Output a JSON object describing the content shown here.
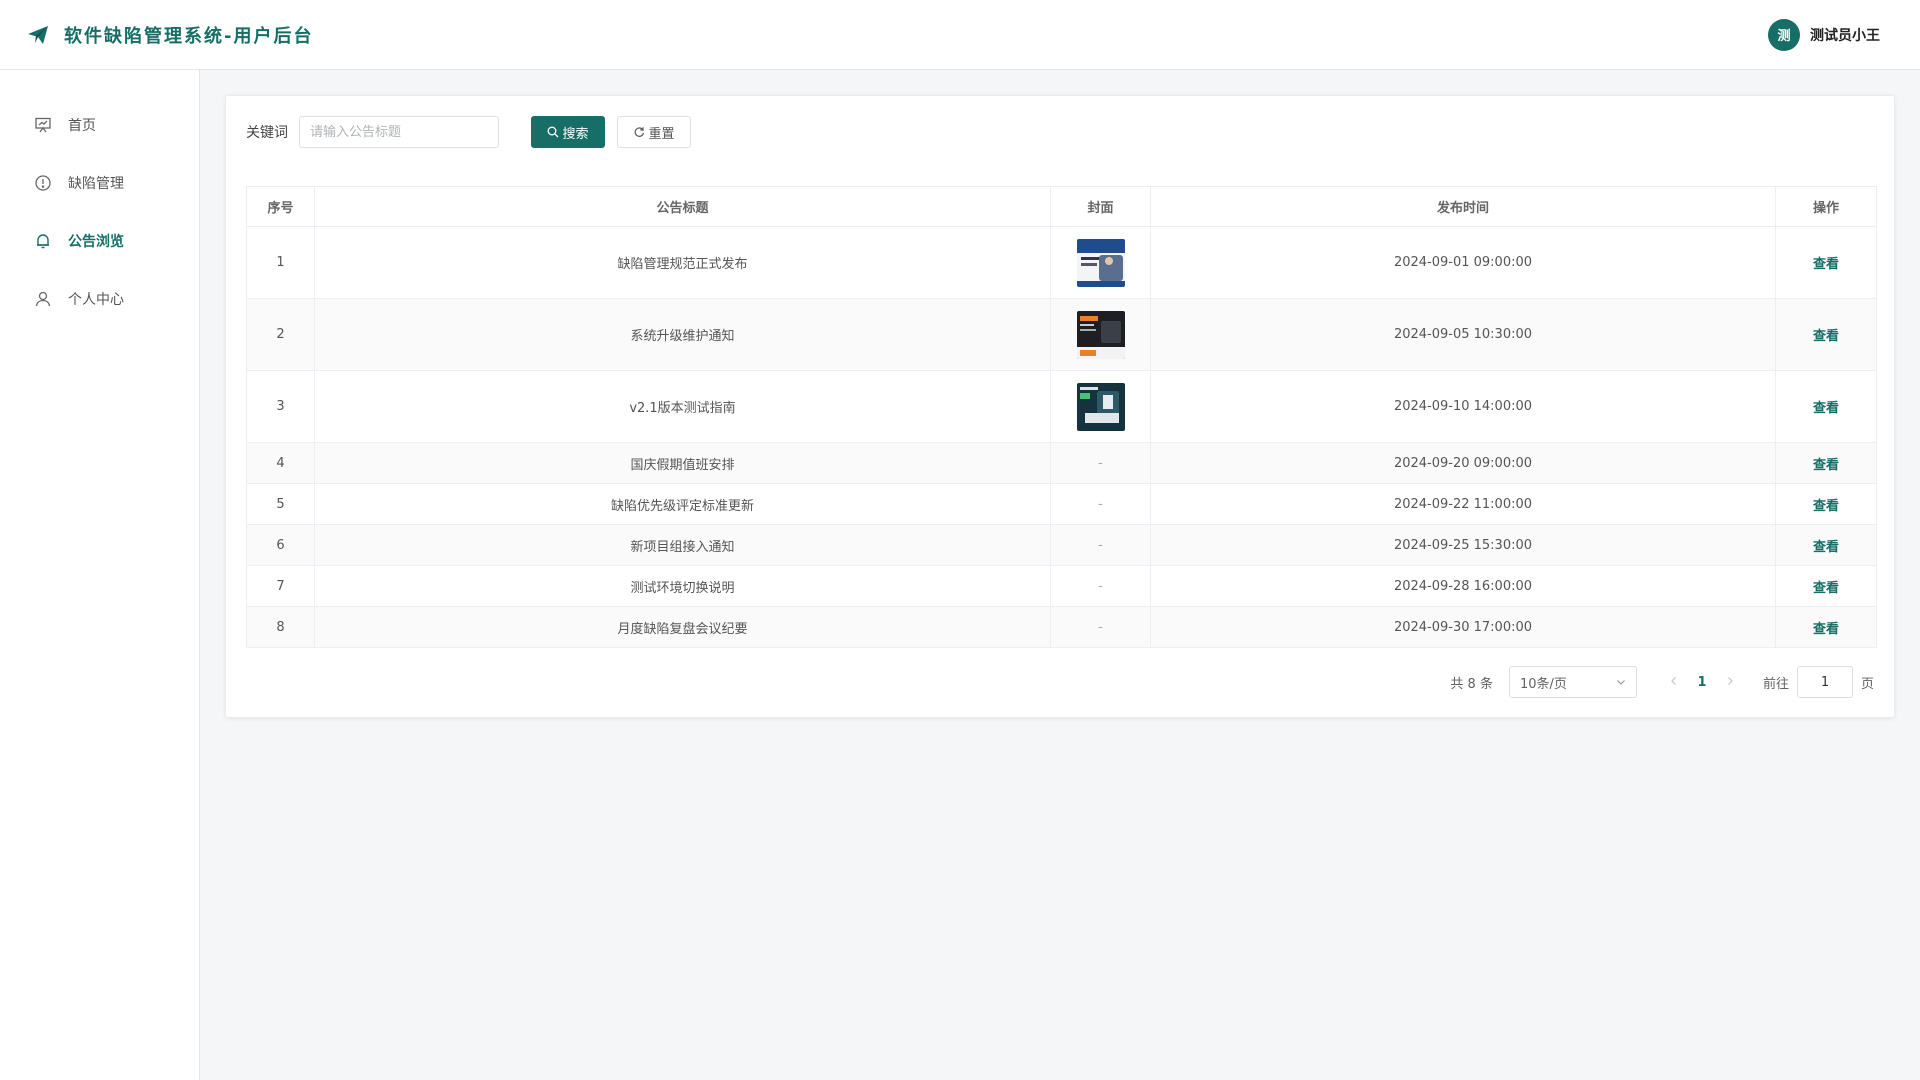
{
  "header": {
    "title": "软件缺陷管理系统-用户后台",
    "brand_icon": "paper-plane-icon",
    "user": {
      "avatar_text": "测",
      "name": "测试员小王"
    }
  },
  "sidebar": {
    "items": [
      {
        "label": "首页",
        "icon": "presentation-board-icon",
        "active": false
      },
      {
        "label": "缺陷管理",
        "icon": "alert-circle-icon",
        "active": false
      },
      {
        "label": "公告浏览",
        "icon": "bell-icon",
        "active": true
      },
      {
        "label": "个人中心",
        "icon": "user-icon",
        "active": false
      }
    ]
  },
  "search": {
    "label": "关键词",
    "placeholder": "请输入公告标题",
    "value": "",
    "search_button": "搜索",
    "reset_button": "重置"
  },
  "table": {
    "columns": [
      "序号",
      "公告标题",
      "封面",
      "发布时间",
      "操作"
    ],
    "rows": [
      {
        "index": "1",
        "title": "缺陷管理规范正式发布",
        "cover": "image",
        "time": "2024-09-01 09:00:00",
        "action": "查看"
      },
      {
        "index": "2",
        "title": "系统升级维护通知",
        "cover": "image",
        "time": "2024-09-05 10:30:00",
        "action": "查看"
      },
      {
        "index": "3",
        "title": "v2.1版本测试指南",
        "cover": "image",
        "time": "2024-09-10 14:00:00",
        "action": "查看"
      },
      {
        "index": "4",
        "title": "国庆假期值班安排",
        "cover": "-",
        "time": "2024-09-20 09:00:00",
        "action": "查看"
      },
      {
        "index": "5",
        "title": "缺陷优先级评定标准更新",
        "cover": "-",
        "time": "2024-09-22 11:00:00",
        "action": "查看"
      },
      {
        "index": "6",
        "title": "新项目组接入通知",
        "cover": "-",
        "time": "2024-09-25 15:30:00",
        "action": "查看"
      },
      {
        "index": "7",
        "title": "测试环境切换说明",
        "cover": "-",
        "time": "2024-09-28 16:00:00",
        "action": "查看"
      },
      {
        "index": "8",
        "title": "月度缺陷复盘会议纪要",
        "cover": "-",
        "time": "2024-09-30 17:00:00",
        "action": "查看"
      }
    ]
  },
  "pagination": {
    "total_text": "共 8 条",
    "page_size": "10条/页",
    "current_page": "1",
    "jump_label": "前往",
    "jump_value": "1",
    "page_suffix": "页"
  },
  "colors": {
    "accent": "#176e66",
    "background": "#f5f6f7"
  }
}
